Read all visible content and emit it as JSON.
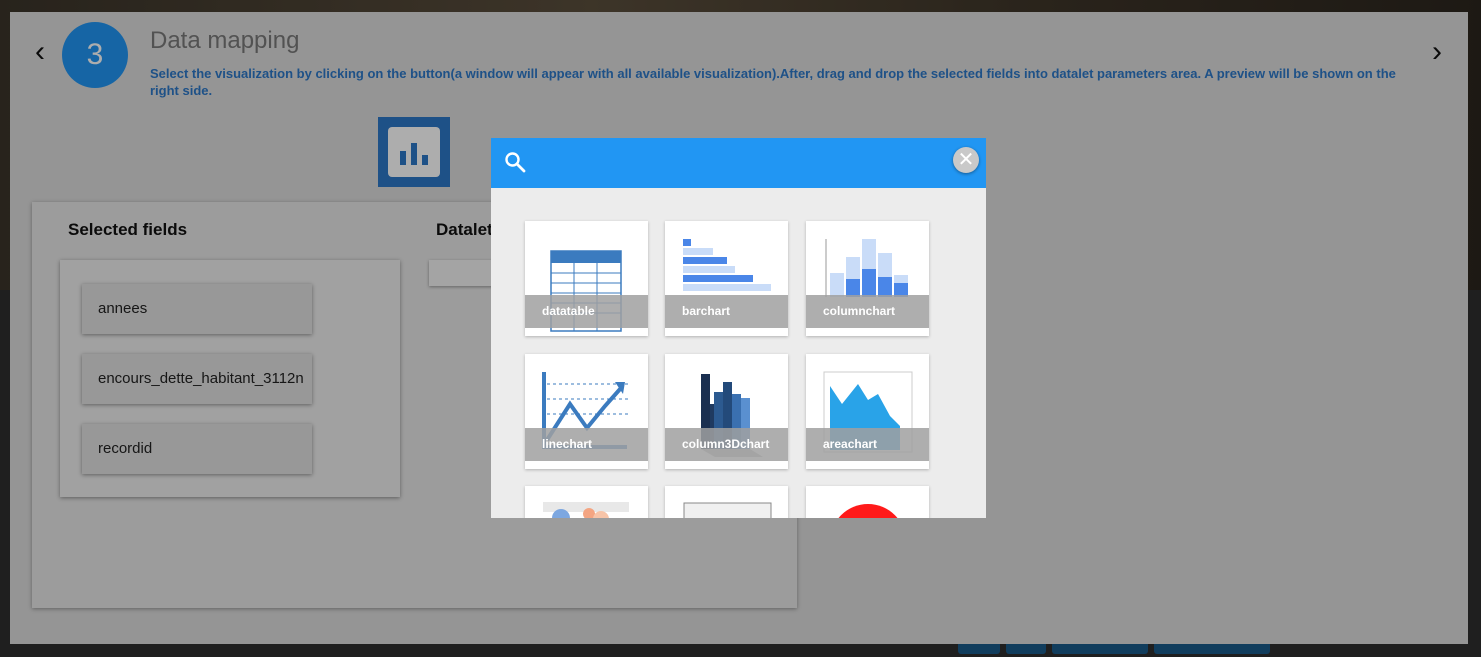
{
  "wizard": {
    "prev_icon": "chevron-left-icon",
    "next_icon": "chevron-right-icon",
    "step_number": "3",
    "title": "Data mapping",
    "description": "Select the visualization by clicking on the button(a window will appear with all available visualization).After, drag and drop the selected fields into datalet parameters area. A preview will be shown on the right side.",
    "viz_button_icon": "bar-chart-icon",
    "accent_color": "#2d78c8"
  },
  "fields_panel": {
    "heading": "Selected fields",
    "fields": [
      "annees",
      "encours_dette_habitant_3112n",
      "recordid"
    ]
  },
  "datalet_panel": {
    "heading": "Datalet"
  },
  "dialog": {
    "search_icon": "search-icon",
    "search_value": "",
    "close_icon": "close-icon",
    "header_color": "#2196f3",
    "visualizations": [
      {
        "label": "datatable",
        "icon": "datatable-thumbnail"
      },
      {
        "label": "barchart",
        "icon": "barchart-thumbnail"
      },
      {
        "label": "columnchart",
        "icon": "columnchart-thumbnail"
      },
      {
        "label": "linechart",
        "icon": "linechart-thumbnail"
      },
      {
        "label": "column3Dchart",
        "icon": "column3dchart-thumbnail"
      },
      {
        "label": "areachart",
        "icon": "areachart-thumbnail"
      },
      {
        "label": "",
        "icon": "bubblechart-thumbnail"
      },
      {
        "label": "",
        "icon": "treemap-thumbnail"
      },
      {
        "label": "",
        "icon": "piechart-thumbnail"
      }
    ]
  }
}
